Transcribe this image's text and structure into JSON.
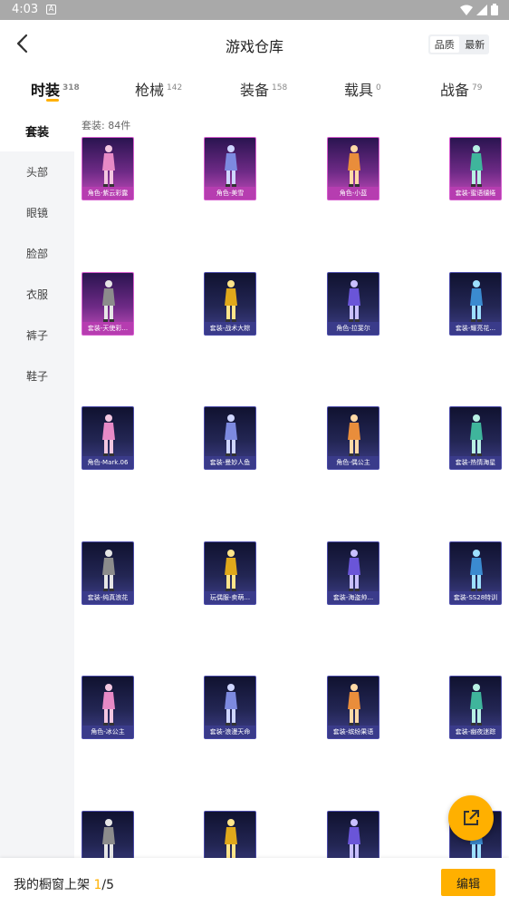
{
  "status_bar": {
    "time": "4:03",
    "notification_glyph": "A"
  },
  "header": {
    "title": "游戏仓库",
    "sort_options": [
      "品质",
      "最新"
    ]
  },
  "tabs": [
    {
      "label": "时装",
      "count": "318"
    },
    {
      "label": "枪械",
      "count": "142"
    },
    {
      "label": "装备",
      "count": "158"
    },
    {
      "label": "载具",
      "count": "0"
    },
    {
      "label": "战备",
      "count": "79"
    }
  ],
  "sidebar": {
    "items": [
      "套装",
      "头部",
      "眼镜",
      "脸部",
      "衣服",
      "裤子",
      "鞋子"
    ]
  },
  "content": {
    "count_label": "套装: 84件",
    "items": [
      {
        "label": "角色-紫云彩露",
        "rarity": "purple"
      },
      {
        "label": "角色-美雪",
        "rarity": "purple"
      },
      {
        "label": "角色-小蓝",
        "rarity": "purple"
      },
      {
        "label": "套装-蜜语缱绻",
        "rarity": "purple"
      },
      {
        "label": "套装-天使彩...",
        "rarity": "purple"
      },
      {
        "label": "套装-战术大粽",
        "rarity": "blue"
      },
      {
        "label": "角色-拉斐尔",
        "rarity": "blue"
      },
      {
        "label": "套装-耀亮花...",
        "rarity": "blue"
      },
      {
        "label": "角色-Mark.06",
        "rarity": "blue"
      },
      {
        "label": "套装-曼妙人鱼",
        "rarity": "blue"
      },
      {
        "label": "角色-偶公主",
        "rarity": "blue"
      },
      {
        "label": "套装-热情海星",
        "rarity": "blue"
      },
      {
        "label": "套装-纯真浪花",
        "rarity": "blue"
      },
      {
        "label": "玩偶服-卖萌...",
        "rarity": "blue"
      },
      {
        "label": "套装-海盗帅...",
        "rarity": "blue"
      },
      {
        "label": "套装-SS28特训",
        "rarity": "blue"
      },
      {
        "label": "角色-冰公主",
        "rarity": "blue"
      },
      {
        "label": "套装-浪漫天命",
        "rarity": "blue"
      },
      {
        "label": "套装-缤纷果语",
        "rarity": "blue"
      },
      {
        "label": "套装-幽夜迷踪",
        "rarity": "blue"
      },
      {
        "label": "",
        "rarity": "blue"
      },
      {
        "label": "",
        "rarity": "blue"
      },
      {
        "label": "",
        "rarity": "blue"
      },
      {
        "label": "",
        "rarity": "blue"
      }
    ]
  },
  "footer": {
    "showcase_prefix": "我的橱窗上架 ",
    "showcase_current": "1",
    "showcase_total": "/5",
    "edit_label": "编辑"
  },
  "colors": {
    "accent": "#ffb000",
    "purple_rarity": "#b63db0",
    "blue_rarity": "#3a3b8a"
  }
}
